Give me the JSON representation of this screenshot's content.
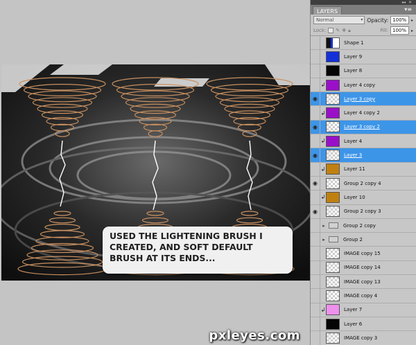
{
  "caption": "USED THE LIGHTENING BRUSH I\nCREATED, AND SOFT DEFAULT\nBRUSH AT ITS ENDS...",
  "panel": {
    "tab_label": "LAYERS",
    "blend_mode": "Normal",
    "opacity_label": "Opacity:",
    "opacity_value": "100%",
    "lock_label": "Lock:",
    "fill_label": "Fill:",
    "fill_value": "100%"
  },
  "layers": [
    {
      "name": "Shape 1",
      "visible": false,
      "selected": false,
      "thumb": "shape",
      "clip": false
    },
    {
      "name": "Layer 9",
      "visible": false,
      "selected": false,
      "thumb": "blue",
      "clip": false
    },
    {
      "name": "Layer 8",
      "visible": false,
      "selected": false,
      "thumb": "black",
      "clip": false
    },
    {
      "name": "Layer 4 copy",
      "visible": false,
      "selected": false,
      "thumb": "purple",
      "clip": true
    },
    {
      "name": "Layer 3 copy",
      "visible": true,
      "selected": true,
      "thumb": "checker",
      "clip": false
    },
    {
      "name": "Layer 4 copy 2",
      "visible": false,
      "selected": false,
      "thumb": "purple",
      "clip": true
    },
    {
      "name": "Layer 3 copy 2",
      "visible": true,
      "selected": true,
      "thumb": "checker",
      "clip": false
    },
    {
      "name": "Layer 4",
      "visible": false,
      "selected": false,
      "thumb": "purple",
      "clip": true
    },
    {
      "name": "Layer 3",
      "visible": true,
      "selected": true,
      "thumb": "checker",
      "clip": false
    },
    {
      "name": "Layer 11",
      "visible": false,
      "selected": false,
      "thumb": "gold",
      "clip": true
    },
    {
      "name": "Group 2 copy 4",
      "visible": true,
      "selected": false,
      "thumb": "checker",
      "clip": false
    },
    {
      "name": "Layer 10",
      "visible": false,
      "selected": false,
      "thumb": "gold",
      "clip": true
    },
    {
      "name": "Group 2 copy 3",
      "visible": true,
      "selected": false,
      "thumb": "checker",
      "clip": false
    },
    {
      "name": "Group 2 copy",
      "visible": false,
      "selected": false,
      "thumb": "folder",
      "clip": false
    },
    {
      "name": "Group 2",
      "visible": false,
      "selected": false,
      "thumb": "folder",
      "clip": false
    },
    {
      "name": "IMAGE copy 15",
      "visible": false,
      "selected": false,
      "thumb": "checker",
      "clip": false
    },
    {
      "name": "IMAGE copy 14",
      "visible": false,
      "selected": false,
      "thumb": "checker",
      "clip": false
    },
    {
      "name": "IMAGE copy 13",
      "visible": false,
      "selected": false,
      "thumb": "checker",
      "clip": false
    },
    {
      "name": "IMAGE copy 4",
      "visible": false,
      "selected": false,
      "thumb": "checker",
      "clip": false
    },
    {
      "name": "Layer 7",
      "visible": false,
      "selected": false,
      "thumb": "pink",
      "clip": true
    },
    {
      "name": "Layer 6",
      "visible": false,
      "selected": false,
      "thumb": "black",
      "clip": false
    },
    {
      "name": "IMAGE copy 3",
      "visible": false,
      "selected": false,
      "thumb": "checker",
      "clip": false
    }
  ],
  "colors": {
    "selection": "#3d95e8",
    "blue": "#1431d8",
    "purple": "#9a10c8",
    "gold": "#c08010",
    "pink": "#ee90ee"
  },
  "watermark": "pxleyes.com"
}
